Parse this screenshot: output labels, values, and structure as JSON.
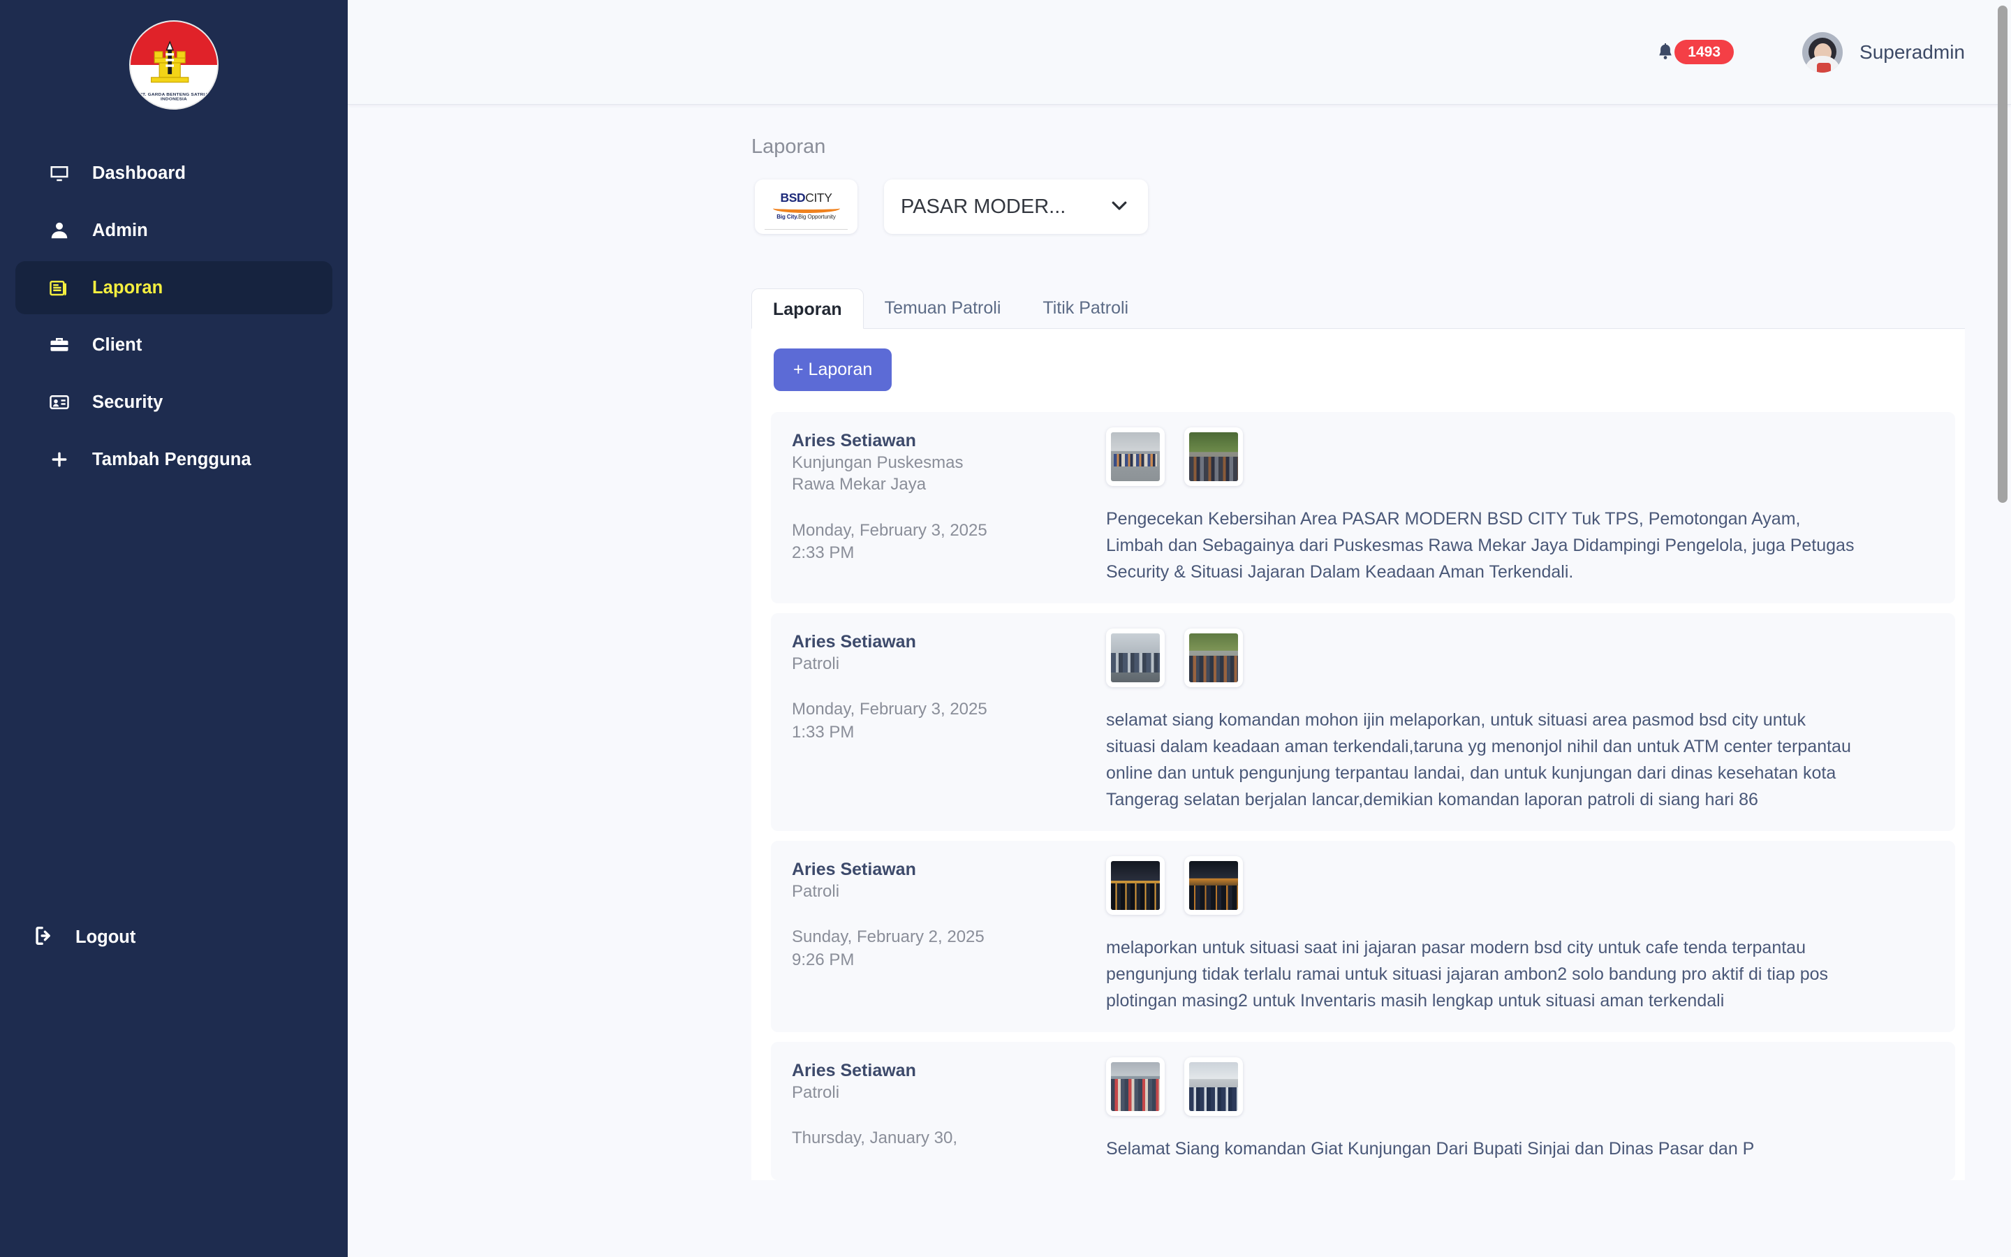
{
  "sidebar": {
    "logo": {
      "ring_text": "PT. GARDA BENTENG SATRIA INDONESIA"
    },
    "items": [
      {
        "label": "Dashboard",
        "icon": "monitor-icon",
        "active": false
      },
      {
        "label": "Admin",
        "icon": "user-icon",
        "active": false
      },
      {
        "label": "Laporan",
        "icon": "report-icon",
        "active": true
      },
      {
        "label": "Client",
        "icon": "briefcase-icon",
        "active": false
      },
      {
        "label": "Security",
        "icon": "id-card-icon",
        "active": false
      },
      {
        "label": "Tambah Pengguna",
        "icon": "plus-icon",
        "active": false
      }
    ],
    "logout_label": "Logout"
  },
  "topbar": {
    "notification_count": "1493",
    "user_name": "Superadmin"
  },
  "page": {
    "title": "Laporan",
    "client_logo": {
      "brand_bold": "BSD",
      "brand_thin": "CITY",
      "tagline_bold": "Big City.",
      "tagline_thin": "Big Opportunity"
    },
    "site_select": {
      "value": "PASAR MODER...",
      "options": [
        "PASAR MODERN BSD CITY"
      ]
    }
  },
  "tabs": [
    {
      "label": "Laporan",
      "active": true
    },
    {
      "label": "Temuan Patroli",
      "active": false
    },
    {
      "label": "Titik Patroli",
      "active": false
    }
  ],
  "actions": {
    "add_report_label": "+ Laporan"
  },
  "reports": [
    {
      "name": "Aries Setiawan",
      "type": "Kunjungan Puskesmas Rawa Mekar Jaya",
      "type_lines": [
        "Kunjungan Puskesmas",
        "Rawa Mekar Jaya"
      ],
      "date": "Monday, February 3, 2025",
      "time": "2:33 PM",
      "description": "Pengecekan Kebersihan Area PASAR MODERN BSD CITY Tuk TPS, Pemotongan Ayam, Limbah dan Sebagainya dari Puskesmas Rawa Mekar Jaya Didampingi Pengelola, juga Petugas Security & Situasi Jajaran Dalam Keadaan Aman Terkendali.",
      "thumbnails": [
        "photo-indoor-market",
        "photo-street-parking"
      ]
    },
    {
      "name": "Aries Setiawan",
      "type": "Patroli",
      "type_lines": [
        "Patroli"
      ],
      "date": "Monday, February 3, 2025",
      "time": "1:33 PM",
      "description": "selamat siang komandan mohon ijin melaporkan, untuk situasi area pasmod bsd city untuk situasi dalam keadaan aman terkendali,taruna yg menonjol nihil dan untuk ATM center terpantau online dan untuk pengunjung terpantau landai, dan untuk kunjungan dari dinas kesehatan kota Tangerag selatan berjalan lancar,demikian komandan laporan patroli di siang hari 86",
      "thumbnails": [
        "photo-shopfront",
        "photo-crowd-street"
      ]
    },
    {
      "name": "Aries Setiawan",
      "type": "Patroli",
      "type_lines": [
        "Patroli"
      ],
      "date": "Sunday, February 2, 2025",
      "time": "9:26 PM",
      "description": "melaporkan untuk situasi saat ini jajaran pasar modern bsd city untuk cafe tenda terpantau pengunjung tidak terlalu ramai untuk situasi jajaran ambon2 solo bandung pro aktif di tiap pos plotingan masing2 untuk Inventaris masih lengkap untuk situasi aman terkendali",
      "thumbnails": [
        "photo-night-market",
        "photo-night-street"
      ]
    },
    {
      "name": "Aries Setiawan",
      "type": "Patroli",
      "type_lines": [
        "Patroli"
      ],
      "date": "Thursday, January 30,",
      "time": "",
      "description": "Selamat Siang komandan Giat Kunjungan Dari Bupati Sinjai dan Dinas Pasar dan P",
      "thumbnails": [
        "photo-fish-market",
        "photo-officials-lineup"
      ]
    }
  ]
}
